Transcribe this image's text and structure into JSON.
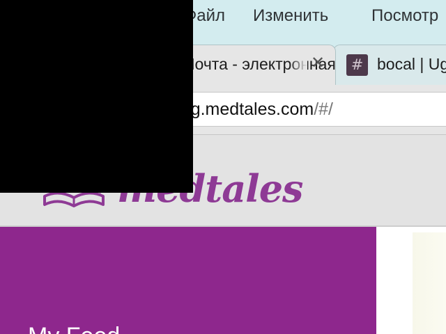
{
  "menubar": {
    "file": "Файл",
    "edit": "Изменить",
    "view": "Посмотр"
  },
  "tabs": [
    {
      "title": "Почта - электронная",
      "close_glyph": "✕",
      "active": true
    },
    {
      "title": "bocal | Ug",
      "favicon_glyph": "#",
      "active": false
    }
  ],
  "address_bar": {
    "host": "staging.medtales.com",
    "path": "/#/"
  },
  "site": {
    "logo_text": "medtales",
    "hero_partial_text": "My Feed"
  },
  "colors": {
    "brand_purple": "#8e278d",
    "logo_purple": "#8e3a95",
    "menubar_bg": "#d3ecef",
    "redaction": "#000000"
  },
  "icons": {
    "tab_close": "close-icon",
    "slack_favicon": "hash-icon",
    "logo": "open-book-icon"
  }
}
